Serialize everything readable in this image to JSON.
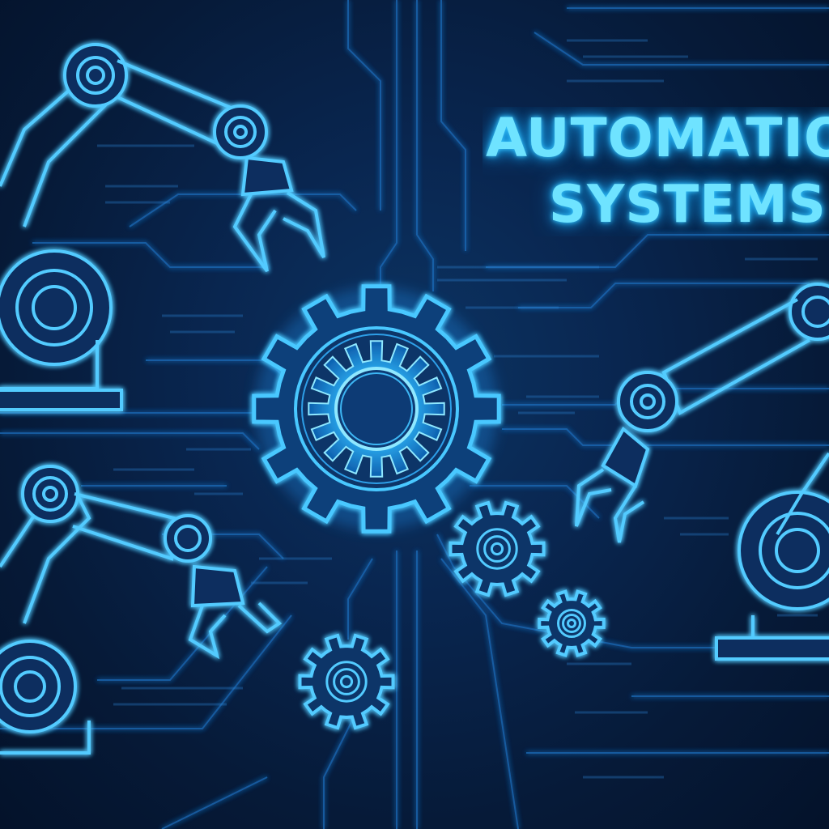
{
  "title": {
    "line1": "AUTOMATIO",
    "line2": "SYSTEMS"
  },
  "colors": {
    "background": "#07182f",
    "glow": "#39c8ff",
    "line": "#1f7fd0",
    "text": "#6fe3ff"
  },
  "icons": [
    "robot-arm-icon",
    "gear-icon"
  ]
}
